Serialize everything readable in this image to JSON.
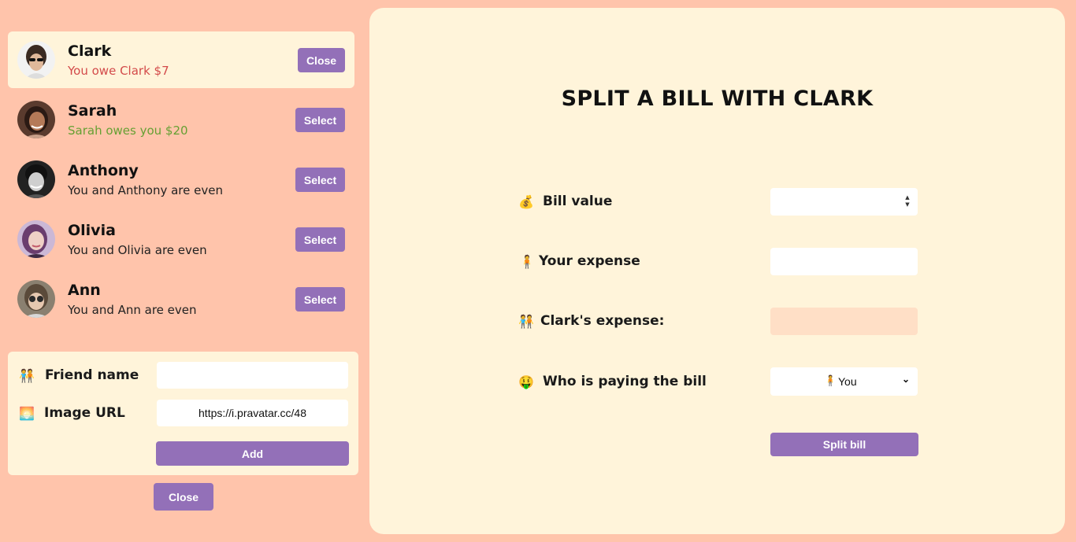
{
  "friends": [
    {
      "name": "Clark",
      "status": "You owe Clark $7",
      "button": "Close",
      "selected": true
    },
    {
      "name": "Sarah",
      "status": "Sarah owes you $20",
      "button": "Select",
      "selected": false
    },
    {
      "name": "Anthony",
      "status": "You and Anthony are even",
      "button": "Select",
      "selected": false
    },
    {
      "name": "Olivia",
      "status": "You and Olivia are even",
      "button": "Select",
      "selected": false
    },
    {
      "name": "Ann",
      "status": "You and Ann are even",
      "button": "Select",
      "selected": false
    }
  ],
  "add_friend": {
    "name_icon": "people-icon",
    "name_label": "Friend name",
    "name_value": "",
    "image_icon": "sunset-image-icon",
    "image_label": "Image URL",
    "image_value": "https://i.pravatar.cc/48",
    "add_label": "Add"
  },
  "close_form_label": "Close",
  "split": {
    "title": "SPLIT A BILL WITH CLARK",
    "bill_label": "Bill value",
    "bill_icon": "money-bag-icon",
    "bill_value": "",
    "your_expense_label": "Your expense",
    "your_expense_icon": "person-icon",
    "your_expense_value": "",
    "friend_expense_label": "Clark's expense:",
    "friend_expense_icon": "people-icon",
    "friend_expense_value": "",
    "payer_label": "Who is paying the bill",
    "payer_icon": "money-mouth-face-icon",
    "payer_selected": "You",
    "split_button_label": "Split bill"
  },
  "colors": {
    "background": "#ffc4ab",
    "panel": "#fff4da",
    "accent": "#9370b8",
    "owe_red": "#d34a4a",
    "owed_green": "#66a033"
  }
}
